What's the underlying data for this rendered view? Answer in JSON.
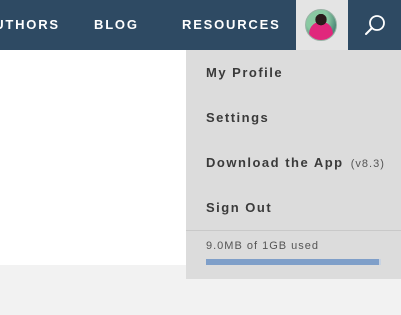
{
  "nav": {
    "items": [
      {
        "label": "AUTHORS"
      },
      {
        "label": "BLOG"
      },
      {
        "label": "RESOURCES"
      }
    ],
    "avatar_icon": "user-avatar",
    "search_icon": "search-icon",
    "background_color": "#2e4a63"
  },
  "dropdown": {
    "items": [
      {
        "label": "My Profile"
      },
      {
        "label": "Settings"
      },
      {
        "label": "Download the App",
        "suffix": "(v8.3)"
      },
      {
        "label": "Sign Out"
      }
    ],
    "storage": {
      "text": "9.0MB of 1GB used",
      "used_fraction": 0.99,
      "bar_color": "#7f9fc9"
    }
  }
}
